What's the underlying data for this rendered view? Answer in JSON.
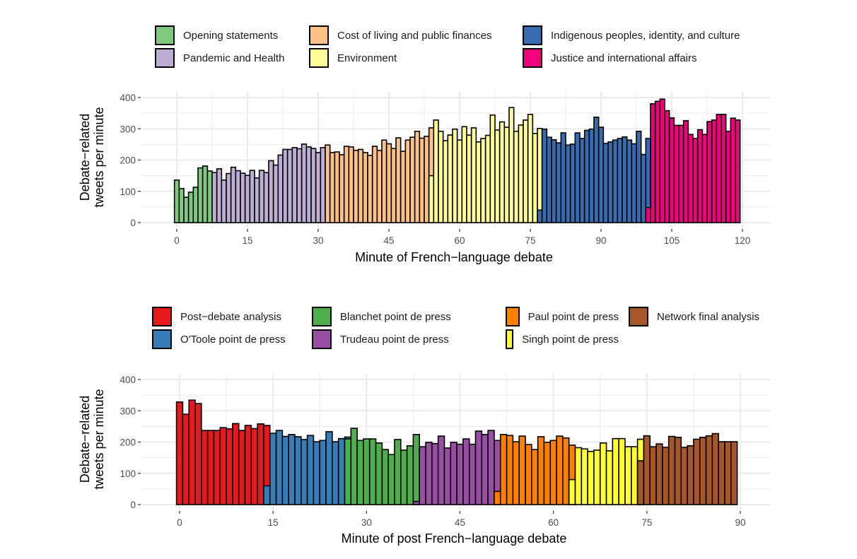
{
  "chart_data": [
    {
      "type": "bar",
      "stacked": true,
      "xlabel": "Minute of French−language debate",
      "ylabel": [
        "Debate−related",
        "tweets per minute"
      ],
      "xlim": [
        -8,
        127
      ],
      "ylim": [
        0,
        420
      ],
      "xticks": [
        0,
        15,
        30,
        45,
        60,
        75,
        90,
        105,
        120
      ],
      "yticks": [
        0,
        100,
        200,
        300,
        400
      ],
      "grid": true,
      "legend_position": "top",
      "legend": [
        {
          "name": "Opening statements",
          "color": "#7fc97f"
        },
        {
          "name": "Cost of living and public finances",
          "color": "#fdc086"
        },
        {
          "name": "Indigenous peoples, identity, and culture",
          "color": "#386cb0"
        },
        {
          "name": "Pandemic and Health",
          "color": "#beaed4"
        },
        {
          "name": "Environment",
          "color": "#ffff99"
        },
        {
          "name": "Justice and international affairs",
          "color": "#f0027f"
        }
      ],
      "segments": [
        {
          "name": "Opening statements",
          "from": 0,
          "to": 7
        },
        {
          "name": "Pandemic and Health",
          "from": 8,
          "to": 31
        },
        {
          "name": "Cost of living and public finances",
          "from": 32,
          "to": 54
        },
        {
          "name": "Environment",
          "from": 55,
          "to": 77
        },
        {
          "name": "Indigenous peoples, identity, and culture",
          "from": 78,
          "to": 100
        },
        {
          "name": "Justice and international affairs",
          "from": 101,
          "to": 119
        }
      ],
      "splits": [
        {
          "minute": 54,
          "lower": "Environment",
          "lower_value": 150
        },
        {
          "minute": 77,
          "lower": "Indigenous peoples, identity, and culture",
          "lower_value": 40
        },
        {
          "minute": 100,
          "lower": "Justice and international affairs",
          "lower_value": 48
        }
      ],
      "x": "minutes 0-119",
      "values": [
        136,
        109,
        81,
        97,
        113,
        175,
        181,
        165,
        160,
        172,
        136,
        157,
        177,
        166,
        158,
        151,
        167,
        143,
        167,
        160,
        198,
        184,
        216,
        234,
        234,
        240,
        236,
        251,
        242,
        237,
        224,
        240,
        248,
        224,
        226,
        217,
        244,
        242,
        231,
        234,
        224,
        215,
        244,
        231,
        264,
        252,
        237,
        271,
        228,
        264,
        273,
        292,
        270,
        276,
        303,
        328,
        292,
        262,
        280,
        299,
        264,
        307,
        280,
        303,
        258,
        269,
        279,
        344,
        296,
        322,
        305,
        368,
        292,
        312,
        328,
        346,
        285,
        301,
        299,
        273,
        265,
        255,
        287,
        248,
        251,
        287,
        269,
        295,
        299,
        337,
        305,
        253,
        258,
        264,
        269,
        274,
        264,
        252,
        292,
        218,
        269,
        380,
        388,
        395,
        358,
        335,
        311,
        311,
        326,
        282,
        269,
        297,
        282,
        323,
        328,
        346,
        346,
        292,
        334,
        328
      ]
    },
    {
      "type": "bar",
      "stacked": true,
      "xlabel": "Minute of post French−language debate",
      "ylabel": [
        "Debate−related",
        "tweets per minute"
      ],
      "xlim": [
        -6,
        95
      ],
      "ylim": [
        0,
        420
      ],
      "xticks": [
        0,
        15,
        30,
        45,
        60,
        75,
        90
      ],
      "yticks": [
        0,
        100,
        200,
        300,
        400
      ],
      "grid": true,
      "legend_position": "top",
      "legend": [
        {
          "name": "Post−debate analysis",
          "color": "#e41a1c"
        },
        {
          "name": "Blanchet point de press",
          "color": "#4daf4a"
        },
        {
          "name": "Paul point de press",
          "color": "#ff7f00"
        },
        {
          "name": "Network final analysis",
          "color": "#a65628"
        },
        {
          "name": "O'Toole point de press",
          "color": "#377eb8"
        },
        {
          "name": "Trudeau point de press",
          "color": "#984ea3"
        },
        {
          "name": "Singh point de press",
          "color": "#ffff33"
        }
      ],
      "segments": [
        {
          "name": "Post−debate analysis",
          "from": 0,
          "to": 14
        },
        {
          "name": "O'Toole point de press",
          "from": 15,
          "to": 27
        },
        {
          "name": "Blanchet point de press",
          "from": 28,
          "to": 38
        },
        {
          "name": "Trudeau point de press",
          "from": 39,
          "to": 51
        },
        {
          "name": "Paul point de press",
          "from": 52,
          "to": 63
        },
        {
          "name": "Singh point de press",
          "from": 64,
          "to": 74
        },
        {
          "name": "Network final analysis",
          "from": 75,
          "to": 89
        }
      ],
      "splits": [
        {
          "minute": 14,
          "lower": "O'Toole point de press",
          "lower_value": 60
        },
        {
          "minute": 27,
          "lower": "Blanchet point de press",
          "lower_value": 210
        },
        {
          "minute": 38,
          "lower": "Trudeau point de press",
          "lower_value": 10
        },
        {
          "minute": 51,
          "lower": "Paul point de press",
          "lower_value": 42
        },
        {
          "minute": 63,
          "lower": "Singh point de press",
          "lower_value": 80
        },
        {
          "minute": 74,
          "lower": "Network final analysis",
          "lower_value": 140
        }
      ],
      "x": "minutes 0-89",
      "values": [
        328,
        289,
        334,
        323,
        237,
        237,
        237,
        246,
        242,
        259,
        237,
        253,
        243,
        258,
        253,
        228,
        237,
        218,
        224,
        217,
        208,
        221,
        201,
        205,
        233,
        201,
        211,
        216,
        244,
        205,
        210,
        210,
        197,
        176,
        160,
        208,
        174,
        188,
        224,
        185,
        199,
        195,
        219,
        181,
        199,
        193,
        210,
        193,
        235,
        224,
        237,
        205,
        224,
        221,
        201,
        219,
        192,
        176,
        217,
        199,
        205,
        219,
        213,
        190,
        182,
        178,
        170,
        174,
        197,
        172,
        211,
        211,
        185,
        185,
        209,
        220,
        185,
        194,
        183,
        218,
        215,
        183,
        188,
        209,
        215,
        220,
        227,
        201,
        201,
        201
      ]
    }
  ]
}
